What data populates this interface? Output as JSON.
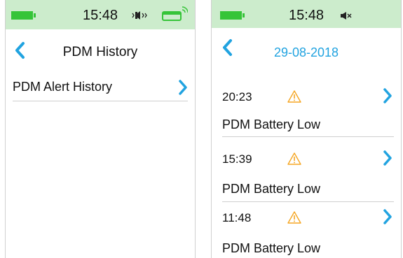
{
  "colors": {
    "accent": "#21a3e0",
    "battery": "#35c438",
    "warning": "#f5a623",
    "statusbar_bg": "#cceccc"
  },
  "left_screen": {
    "status": {
      "time": "15:48",
      "icons": [
        "battery-icon",
        "vibrate-icon",
        "pod-signal-icon"
      ]
    },
    "nav": {
      "title": "PDM History"
    },
    "menu": [
      {
        "label": "PDM Alert History"
      }
    ]
  },
  "right_screen": {
    "status": {
      "time": "15:48",
      "icons": [
        "battery-icon",
        "speaker-muted-icon"
      ]
    },
    "nav": {
      "title": "29-08-2018"
    },
    "alerts": [
      {
        "time": "20:23",
        "message": "PDM Battery Low"
      },
      {
        "time": "15:39",
        "message": "PDM Battery Low"
      },
      {
        "time": "11:48",
        "message": "PDM Battery Low"
      }
    ]
  }
}
